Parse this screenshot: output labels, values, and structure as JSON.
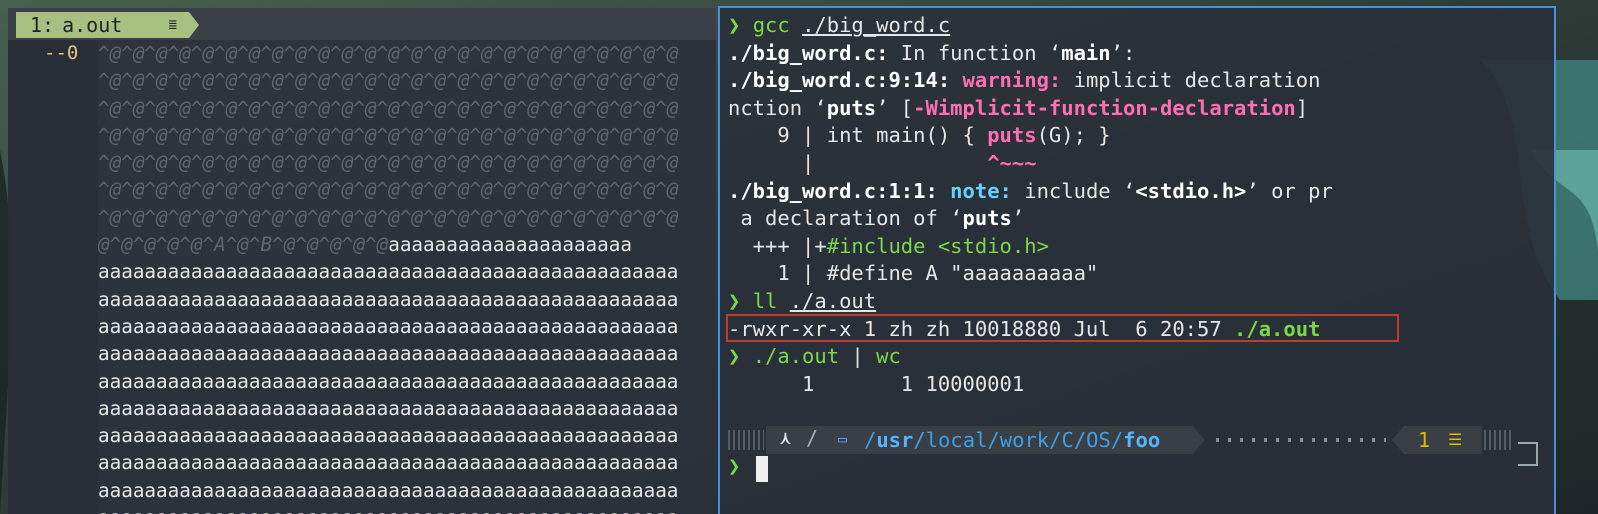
{
  "vim": {
    "tab_number": "1:",
    "tab_name": "a.out",
    "tab_icon": "list-icon",
    "line_number": "--0",
    "buffer_lines": [
      [
        {
          "t": "^@^@^@^@^@^@^@^@^@^@^@^@^@^@^@^@^@^@^@^@^@^@^@^@^@",
          "c": "ctrl"
        }
      ],
      [
        {
          "t": "^@^@^@^@^@^@^@^@^@^@^@^@^@^@^@^@^@^@^@^@^@^@^@^@^@",
          "c": "ctrl"
        }
      ],
      [
        {
          "t": "^@^@^@^@^@^@^@^@^@^@^@^@^@^@^@^@^@^@^@^@^@^@^@^@^@",
          "c": "ctrl"
        }
      ],
      [
        {
          "t": "^@^@^@^@^@^@^@^@^@^@^@^@^@^@^@^@^@^@^@^@^@^@^@^@^@",
          "c": "ctrl"
        }
      ],
      [
        {
          "t": "^@^@^@^@^@^@^@^@^@^@^@^@^@^@^@^@^@^@^@^@^@^@^@^@^@",
          "c": "ctrl"
        }
      ],
      [
        {
          "t": "^@^@^@^@^@^@^@^@^@^@^@^@^@^@^@^@^@^@^@^@^@^@^@^@^@",
          "c": "ctrl"
        }
      ],
      [
        {
          "t": "^@^@^@^@^@^@^@^@^@^@^@^@^@^@^@^@^@^@^@^@^@^@^@^@^@",
          "c": "ctrl"
        }
      ],
      [
        {
          "t": "@^@^@^@^@^A^@^B^@^@^@^@^@",
          "c": "ctrl"
        },
        {
          "t": "aaaaaaaaaaaaaaaaaaaaa",
          "c": "txt"
        }
      ],
      [
        {
          "t": "aaaaaaaaaaaaaaaaaaaaaaaaaaaaaaaaaaaaaaaaaaaaaaaaaa",
          "c": "txt"
        }
      ],
      [
        {
          "t": "aaaaaaaaaaaaaaaaaaaaaaaaaaaaaaaaaaaaaaaaaaaaaaaaaa",
          "c": "txt"
        }
      ],
      [
        {
          "t": "aaaaaaaaaaaaaaaaaaaaaaaaaaaaaaaaaaaaaaaaaaaaaaaaaa",
          "c": "txt"
        }
      ],
      [
        {
          "t": "aaaaaaaaaaaaaaaaaaaaaaaaaaaaaaaaaaaaaaaaaaaaaaaaaa",
          "c": "txt"
        }
      ],
      [
        {
          "t": "aaaaaaaaaaaaaaaaaaaaaaaaaaaaaaaaaaaaaaaaaaaaaaaaaa",
          "c": "txt"
        }
      ],
      [
        {
          "t": "aaaaaaaaaaaaaaaaaaaaaaaaaaaaaaaaaaaaaaaaaaaaaaaaaa",
          "c": "txt"
        }
      ],
      [
        {
          "t": "aaaaaaaaaaaaaaaaaaaaaaaaaaaaaaaaaaaaaaaaaaaaaaaaaa",
          "c": "txt"
        }
      ],
      [
        {
          "t": "aaaaaaaaaaaaaaaaaaaaaaaaaaaaaaaaaaaaaaaaaaaaaaaaaa",
          "c": "txt"
        }
      ],
      [
        {
          "t": "aaaaaaaaaaaaaaaaaaaaaaaaaaaaaaaaaaaaaaaaaaaaaaaaaa",
          "c": "txt"
        }
      ],
      [
        {
          "t": "aaaaaaaaaaaaaaaaaaaaaaaaaaaaaaaaaaaaaaaaaaaaaaaaaa",
          "c": "txt"
        }
      ]
    ]
  },
  "terminal": {
    "lines": [
      [
        {
          "t": "❯ ",
          "c": "prompt"
        },
        {
          "t": "gcc ",
          "c": "cmd"
        },
        {
          "t": "./big_word.c",
          "c": "u"
        }
      ],
      [
        {
          "t": "./big_word.c:",
          "c": "b"
        },
        {
          "t": " In function ‘"
        },
        {
          "t": "main",
          "c": "b"
        },
        {
          "t": "’:"
        }
      ],
      [
        {
          "t": "./big_word.c:9:14:",
          "c": "b"
        },
        {
          "t": " "
        },
        {
          "t": "warning:",
          "c": "warn"
        },
        {
          "t": " implicit declaration"
        }
      ],
      [
        {
          "t": "nction ‘"
        },
        {
          "t": "puts",
          "c": "b"
        },
        {
          "t": "’ ["
        },
        {
          "t": "-Wimplicit-function-declaration",
          "c": "warn"
        },
        {
          "t": "]"
        }
      ],
      [
        {
          "t": "    9 | int main() { "
        },
        {
          "t": "puts",
          "c": "warn"
        },
        {
          "t": "(G); }"
        }
      ],
      [
        {
          "t": "      |              "
        },
        {
          "t": "^~~~",
          "c": "caret"
        }
      ],
      [
        {
          "t": "./big_word.c:1:1:",
          "c": "b"
        },
        {
          "t": " "
        },
        {
          "t": "note:",
          "c": "note"
        },
        {
          "t": " include ‘"
        },
        {
          "t": "<stdio.h>",
          "c": "b"
        },
        {
          "t": "’ or pr"
        }
      ],
      [
        {
          "t": " a declaration of ‘"
        },
        {
          "t": "puts",
          "c": "b"
        },
        {
          "t": "’"
        }
      ],
      [
        {
          "t": "  +++ |+"
        },
        {
          "t": "#include <stdio.h>",
          "c": "inc"
        }
      ],
      [
        {
          "t": "    1 | #define A \"aaaaaaaaaa\""
        }
      ],
      [
        {
          "t": "❯ ",
          "c": "prompt"
        },
        {
          "t": "ll ",
          "c": "cmd"
        },
        {
          "t": "./a.out",
          "c": "u"
        }
      ],
      [
        {
          "t": "-rwxr-xr-x 1 zh zh 10018880 Jul  6 20:57 "
        },
        {
          "t": "./a.out",
          "c": "exe"
        }
      ],
      [
        {
          "t": "❯ ",
          "c": "prompt"
        },
        {
          "t": "./a.out",
          "c": "cmd"
        },
        {
          "t": " | "
        },
        {
          "t": "wc",
          "c": "cmd"
        }
      ],
      [
        {
          "t": "      1       1 10000001"
        }
      ]
    ],
    "statusline": {
      "os_icon": "arch-icon",
      "path_prefix": "/",
      "path_part_usr": "usr",
      "path_middle": "/local/work/C/OS/",
      "path_last": "foo",
      "jobs_count": "1",
      "jobs_icon": "jobs-icon"
    },
    "input_prompt": "❯"
  }
}
